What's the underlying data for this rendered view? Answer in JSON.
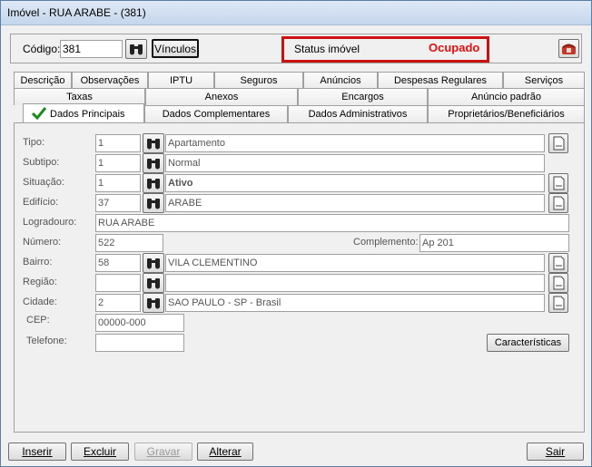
{
  "window": {
    "title": "Imóvel - RUA ARABE - (381)"
  },
  "header": {
    "codigo_label": "Código:",
    "codigo_value": "381",
    "vinculos_label": "Vínculos",
    "status_label": "Status imóvel",
    "status_value": "Ocupado"
  },
  "tabs": {
    "row1": [
      "Descrição",
      "Observações",
      "IPTU",
      "Seguros",
      "Anúncios",
      "Despesas Regulares",
      "Serviços"
    ],
    "row2": [
      "Taxas",
      "Anexos",
      "Encargos",
      "Anúncio padrão"
    ],
    "row3": [
      "Dados Principais",
      "Dados Complementares",
      "Dados Administrativos",
      "Proprietários/Beneficiários"
    ],
    "active": "Dados Principais"
  },
  "form": {
    "tipo": {
      "label": "Tipo:",
      "code": "1",
      "desc": "Apartamento"
    },
    "subtipo": {
      "label": "Subtipo:",
      "code": "1",
      "desc": "Normal"
    },
    "situacao": {
      "label": "Situação:",
      "code": "1",
      "desc": "Ativo"
    },
    "edificio": {
      "label": "Edifício:",
      "code": "37",
      "desc": "ARABE"
    },
    "logradouro": {
      "label": "Logradouro:",
      "value": "RUA ARABE"
    },
    "numero": {
      "label": "Número:",
      "value": "522"
    },
    "complemento": {
      "label": "Complemento:",
      "value": "Ap 201"
    },
    "bairro": {
      "label": "Bairro:",
      "code": "58",
      "desc": "VILA CLEMENTINO"
    },
    "regiao": {
      "label": "Região:",
      "code": "",
      "desc": ""
    },
    "cidade": {
      "label": "Cidade:",
      "code": "2",
      "desc": "SAO PAULO - SP - Brasil"
    },
    "cep": {
      "label": "CEP:",
      "value": "00000-000"
    },
    "telefone": {
      "label": "Telefone:",
      "value": ""
    },
    "caracteristicas_label": "Características"
  },
  "footer": {
    "inserir": "Inserir",
    "excluir": "Excluir",
    "gravar": "Gravar",
    "alterar": "Alterar",
    "sair": "Sair"
  },
  "colors": {
    "status": "#e01010",
    "status_border": "#cc1111",
    "check": "#1a8c1a"
  },
  "icons": [
    "binoculars-icon",
    "phone-icon",
    "checkmark-icon",
    "document-icon"
  ]
}
